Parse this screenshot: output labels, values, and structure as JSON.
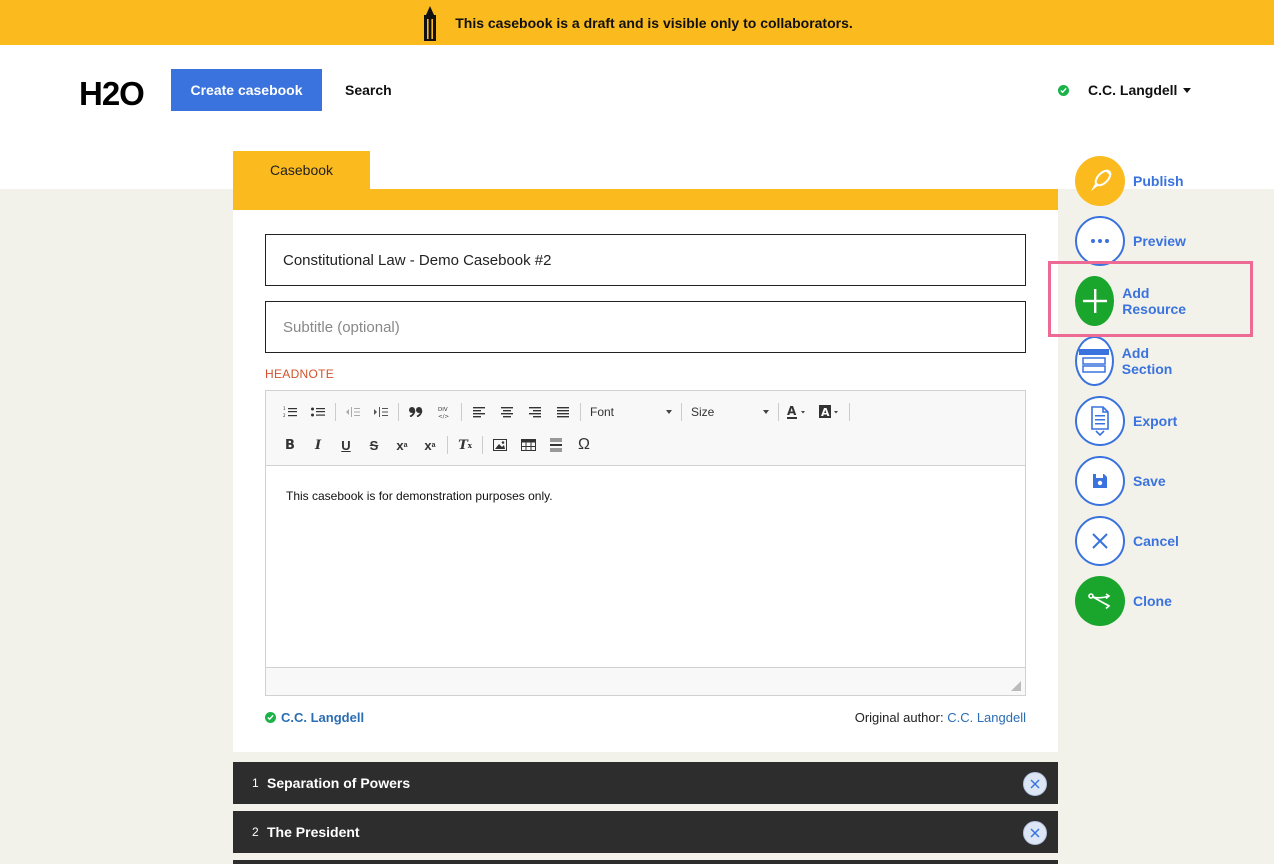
{
  "banner": {
    "text": "This casebook is a draft and is visible only to collaborators."
  },
  "header": {
    "logo": "H2O",
    "create_button": "Create casebook",
    "search_link": "Search",
    "user_name": "C.C. Langdell"
  },
  "tabs": [
    {
      "label": "Casebook"
    }
  ],
  "form": {
    "title_value": "Constitutional Law - Demo Casebook #2",
    "subtitle_placeholder": "Subtitle (optional)",
    "headnote_label": "HEADNOTE",
    "editor": {
      "font_combo": "Font",
      "size_combo": "Size",
      "content": "This casebook is for demonstration purposes only."
    },
    "collaborator": "C.C. Langdell",
    "original_author_label": "Original author:",
    "original_author": "C.C. Langdell"
  },
  "sections": [
    {
      "number": "1",
      "title": "Separation of Powers"
    },
    {
      "number": "2",
      "title": "The President"
    }
  ],
  "actions": [
    {
      "label": "Publish",
      "icon": "publish-icon"
    },
    {
      "label": "Preview",
      "icon": "ellipsis-icon"
    },
    {
      "label": "Add Resource",
      "icon": "plus-icon"
    },
    {
      "label": "Add Section",
      "icon": "section-icon"
    },
    {
      "label": "Export",
      "icon": "document-icon"
    },
    {
      "label": "Save",
      "icon": "floppy-icon"
    },
    {
      "label": "Cancel",
      "icon": "close-icon"
    },
    {
      "label": "Clone",
      "icon": "clone-icon"
    }
  ],
  "colors": {
    "accent_yellow": "#fbba1e",
    "primary_blue": "#3a73dd",
    "green": "#1aa52d",
    "highlight": "#ec6a93"
  }
}
